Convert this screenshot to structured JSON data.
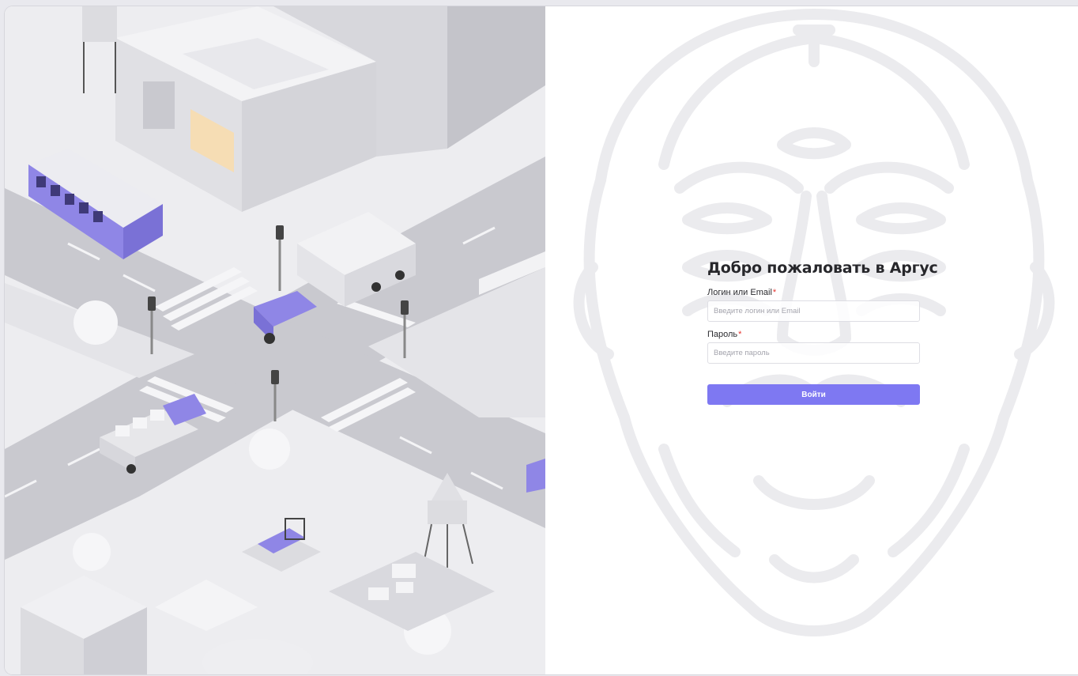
{
  "login": {
    "title": "Добро пожаловать в Аргус",
    "login_field": {
      "label": "Логин или Email",
      "required_mark": "*",
      "placeholder": "Введите логин или Email",
      "value": ""
    },
    "password_field": {
      "label": "Пароль",
      "required_mark": "*",
      "placeholder": "Введите пароль",
      "value": ""
    },
    "submit_label": "Войти"
  },
  "colors": {
    "accent": "#7e78f2",
    "required": "#e5322d",
    "title": "#27272b",
    "illustration_accent": "#8f86e6"
  },
  "icons": {
    "illustration": "isometric-city-illustration",
    "watermark": "argus-face-watermark"
  }
}
